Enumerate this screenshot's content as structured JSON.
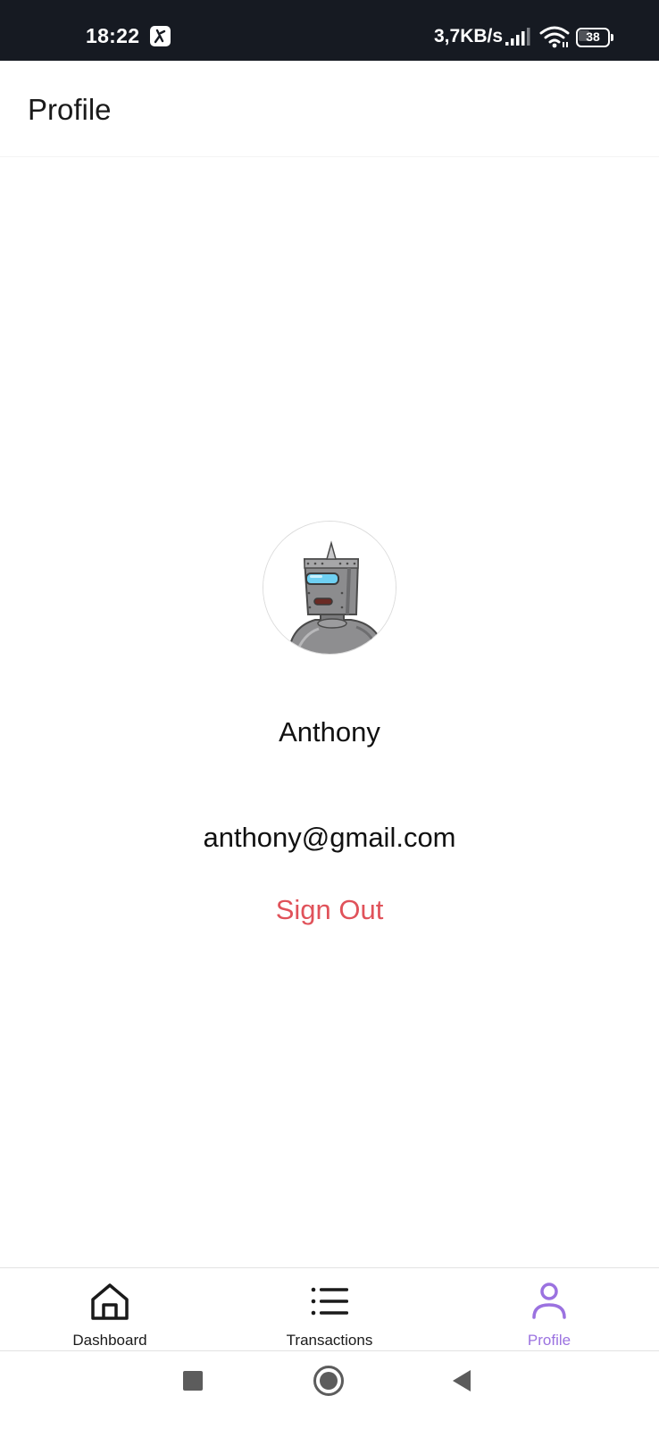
{
  "status_bar": {
    "time": "18:22",
    "network_speed": "3,7KB/s",
    "battery": "38",
    "icons": [
      "app-notification-icon",
      "signal-icon",
      "wifi-icon",
      "battery-icon"
    ]
  },
  "header": {
    "title": "Profile"
  },
  "profile": {
    "avatar_icon": "robot-avatar",
    "name": "Anthony",
    "email": "anthony@gmail.com",
    "sign_out_label": "Sign Out",
    "sign_out_color": "#e0525a"
  },
  "bottom_nav": {
    "active_color": "#9b72e0",
    "tabs": [
      {
        "label": "Dashboard",
        "icon": "home-icon",
        "active": false
      },
      {
        "label": "Transactions",
        "icon": "list-icon",
        "active": false
      },
      {
        "label": "Profile",
        "icon": "user-icon",
        "active": true
      }
    ]
  },
  "system_nav": {
    "buttons": [
      "recents-icon",
      "home-circle-icon",
      "back-triangle-icon"
    ]
  }
}
